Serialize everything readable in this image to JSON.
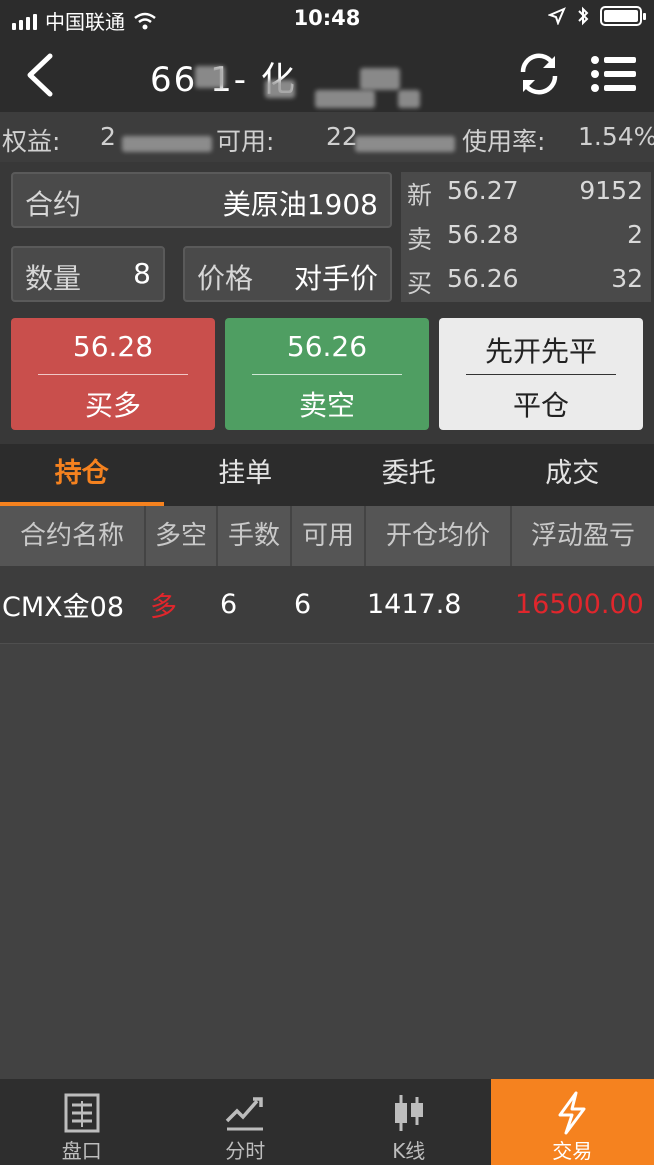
{
  "status_bar": {
    "carrier": "中国联通",
    "time": "10:48"
  },
  "nav": {
    "title_visible": "66    1-      化"
  },
  "account": {
    "equity_label": "权益:",
    "equity_value": "2",
    "available_label": "可用:",
    "available_value": "22",
    "usage_label": "使用率:",
    "usage_value": "1.54%"
  },
  "order": {
    "contract_label": "合约",
    "contract_value": "美原油1908",
    "qty_label": "数量",
    "qty_value": "8",
    "price_label": "价格",
    "price_value": "对手价"
  },
  "quote": [
    {
      "key": "新",
      "price": "56.27",
      "vol": "9152"
    },
    {
      "key": "卖",
      "price": "56.28",
      "vol": "2"
    },
    {
      "key": "买",
      "price": "56.26",
      "vol": "32"
    }
  ],
  "buttons": {
    "buy_price": "56.28",
    "buy_label": "买多",
    "sell_price": "56.26",
    "sell_label": "卖空",
    "close_mode": "先开先平",
    "close_label": "平仓"
  },
  "tabs": [
    "持仓",
    "挂单",
    "委托",
    "成交"
  ],
  "table": {
    "headers": [
      "合约名称",
      "多空",
      "手数",
      "可用",
      "开仓均价",
      "浮动盈亏"
    ],
    "rows": [
      {
        "name": "CMX金08",
        "side": "多",
        "qty": "6",
        "avail": "6",
        "avg": "1417.8",
        "pnl": "16500.00"
      }
    ]
  },
  "bottom_nav": [
    {
      "label": "盘口",
      "icon": "list-icon"
    },
    {
      "label": "分时",
      "icon": "trend-icon"
    },
    {
      "label": "K线",
      "icon": "candlestick-icon"
    },
    {
      "label": "交易",
      "icon": "lightning-icon"
    }
  ],
  "colors": {
    "accent": "#f5821f",
    "buy": "#c94f4c",
    "sell": "#4f9e62",
    "profit": "#e0262c"
  }
}
